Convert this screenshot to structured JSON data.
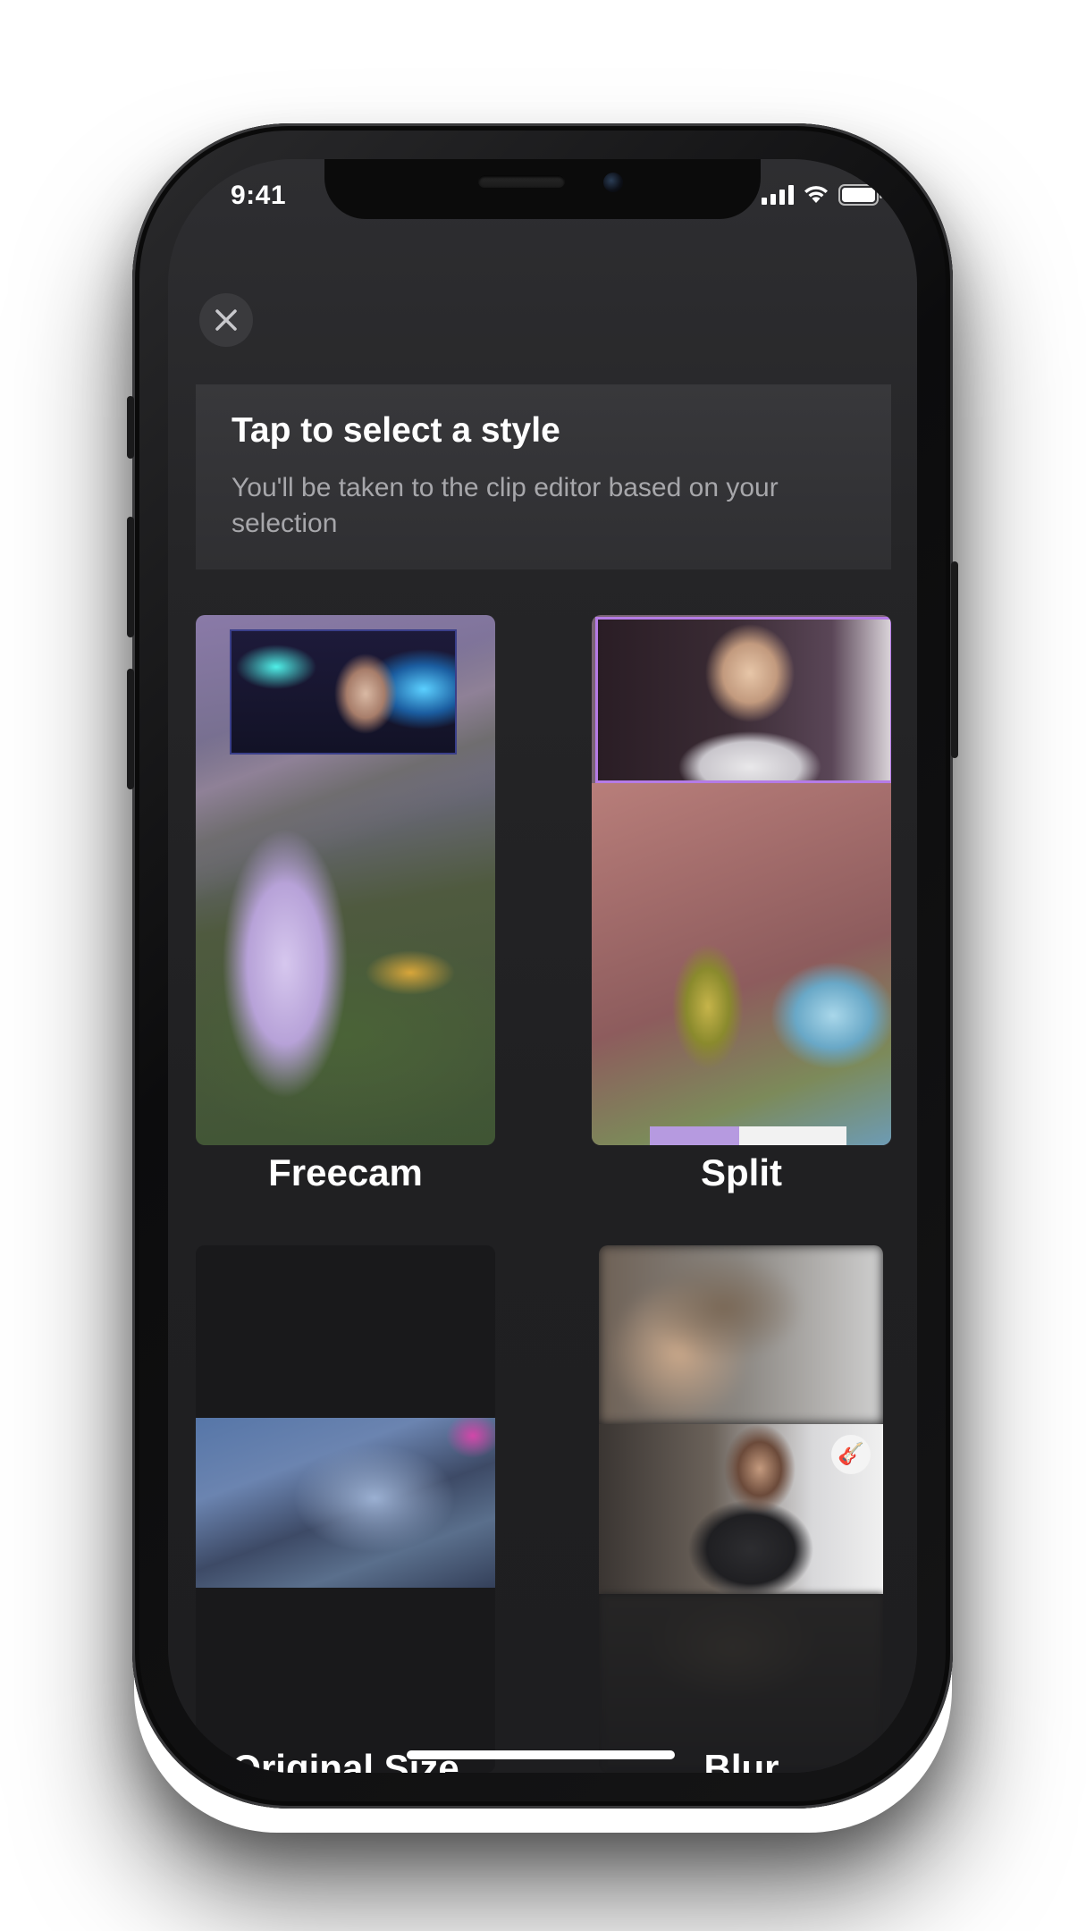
{
  "status_bar": {
    "time": "9:41"
  },
  "header": {
    "title": "Tap to select a style",
    "subtitle": "You'll be taken to the clip editor based on your selection"
  },
  "styles": [
    {
      "label": "Freecam"
    },
    {
      "label": "Split"
    },
    {
      "label": "Original Size"
    },
    {
      "label": "Blur"
    }
  ],
  "icons": [
    "close-icon",
    "cellular-signal-icon",
    "wifi-icon",
    "battery-icon"
  ],
  "colors": {
    "screen_bg": "#232325",
    "card_bg": "#333336",
    "text_primary": "#ffffff",
    "text_secondary": "#a7a7ab"
  }
}
